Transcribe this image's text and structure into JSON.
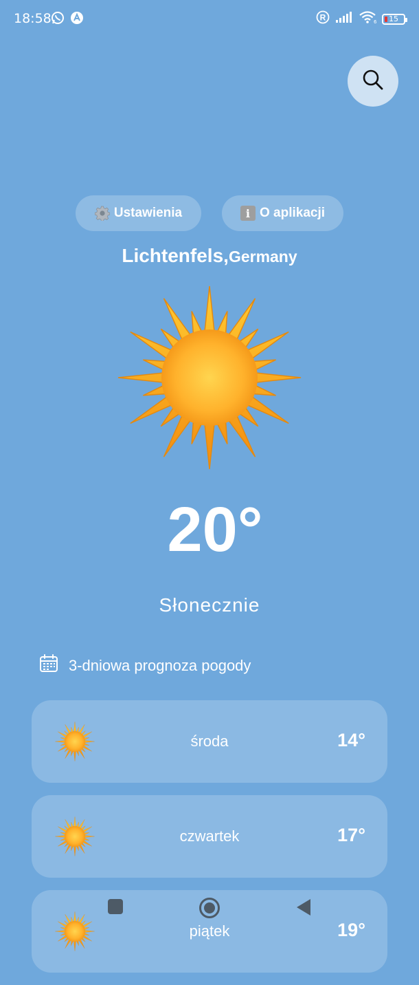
{
  "status_bar": {
    "time": "18:58",
    "battery": "15",
    "icons": [
      "whatsapp-icon",
      "app-notification-icon",
      "registered-icon",
      "signal-icon",
      "wifi-icon",
      "battery-icon"
    ]
  },
  "search": {
    "icon": "search-icon"
  },
  "menu": {
    "settings_label": "Ustawienia",
    "settings_icon": "gear-icon",
    "about_label": "O aplikacji",
    "about_icon": "info-icon"
  },
  "location": {
    "city": "Lichtenfels,",
    "country": "Germany"
  },
  "current": {
    "icon": "sun-icon",
    "temperature": "20°",
    "condition": "Słonecznie"
  },
  "forecast": {
    "title": "3-dniowa prognoza pogody",
    "title_icon": "calendar-icon",
    "days": [
      {
        "day": "środa",
        "temp": "14°",
        "icon": "sun-icon"
      },
      {
        "day": "czwartek",
        "temp": "17°",
        "icon": "sun-icon"
      },
      {
        "day": "piątek",
        "temp": "19°",
        "icon": "sun-icon"
      }
    ]
  },
  "nav": {
    "icons": [
      "recents-icon",
      "home-icon",
      "back-icon"
    ]
  },
  "colors": {
    "background": "#6fa8dc",
    "search_button": "#cfe2f3",
    "sun_core": "#ffc23a",
    "sun_rays": "#f7a21b"
  }
}
